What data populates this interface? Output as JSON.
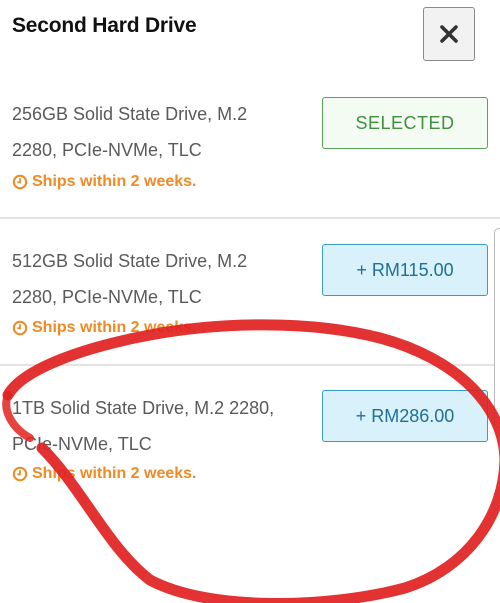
{
  "header": {
    "title": "Second Hard Drive",
    "close_icon": "close-icon"
  },
  "options": [
    {
      "line1": "256GB Solid State Drive, M.2",
      "line2": "2280, PCIe-NVMe, TLC",
      "ships": "Ships within 2 weeks.",
      "button": "SELECTED"
    },
    {
      "line1": "512GB Solid State Drive, M.2",
      "line2": "2280, PCIe-NVMe, TLC",
      "ships": "Ships within 2 weeks.",
      "button": "+ RM115.00"
    },
    {
      "line1": "1TB Solid State Drive, M.2 2280,",
      "line2": "PCIe-NVMe, TLC",
      "ships": "Ships within 2 weeks.",
      "button": "+ RM286.00"
    }
  ],
  "colors": {
    "ships_orange": "#f08a24",
    "selected_green": "#3f8f3f",
    "price_blue": "#1f6f98",
    "annotation_red": "#e0211f"
  }
}
